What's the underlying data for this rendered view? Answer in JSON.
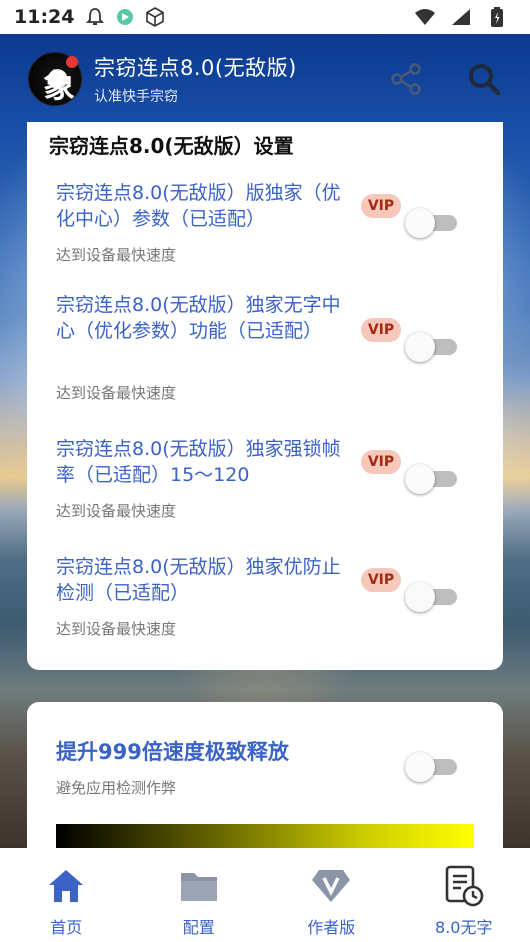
{
  "status_bar": {
    "time": "11:24"
  },
  "header": {
    "title": "宗窃连点8.0(无敌版)",
    "subtitle": "认准快手宗窃",
    "share_icon": "share-icon",
    "search_icon": "search-icon"
  },
  "settings_card": {
    "title": "宗窃连点8.0(无敌版）设置",
    "items": [
      {
        "label": "宗窃连点8.0(无敌版）版独家（优化中心）参数（已适配）",
        "desc": "达到设备最快速度",
        "badge": "VIP",
        "enabled": false
      },
      {
        "label": "宗窃连点8.0(无敌版）独家无字中心（优化参数）功能（已适配）",
        "desc": "达到设备最快速度",
        "badge": "VIP",
        "enabled": false
      },
      {
        "label": "宗窃连点8.0(无敌版）独家强锁帧率（已适配）15～120",
        "desc": "达到设备最快速度",
        "badge": "VIP",
        "enabled": false
      },
      {
        "label": "宗窃连点8.0(无敌版）独家优防止检测（已适配）",
        "desc": "达到设备最快速度",
        "badge": "VIP",
        "enabled": false
      }
    ]
  },
  "boost_card": {
    "title": "提升999倍速度极致释放",
    "desc": "避免应用检测作弊",
    "enabled": false
  },
  "bottom_nav": [
    {
      "label": "首页",
      "icon": "home-icon",
      "active": true
    },
    {
      "label": "配置",
      "icon": "folder-icon",
      "active": false
    },
    {
      "label": "作者版",
      "icon": "vip-diamond-icon",
      "active": false
    },
    {
      "label": "8.0无字",
      "icon": "document-clock-icon",
      "active": false
    }
  ],
  "colors": {
    "accent": "#3b62c7",
    "vip_bg": "#f6c7bb",
    "vip_text": "#a52a12"
  }
}
